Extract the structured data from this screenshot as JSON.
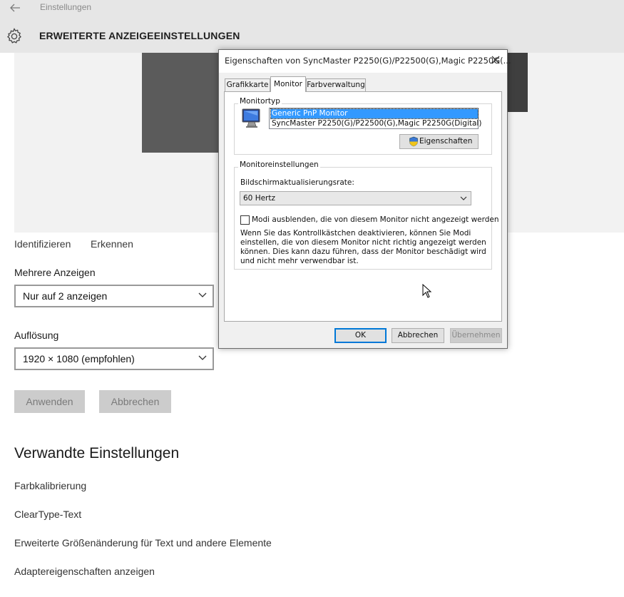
{
  "window": {
    "app_title": "Einstellungen",
    "page_title": "ERWEITERTE ANZEIGEEINSTELLUNGEN"
  },
  "display": {
    "identify_label": "Identifizieren",
    "detect_label": "Erkennen",
    "multi_label": "Mehrere Anzeigen",
    "multi_value": "Nur auf 2 anzeigen",
    "resolution_label": "Auflösung",
    "resolution_value": "1920 × 1080 (empfohlen)",
    "apply_label": "Anwenden",
    "cancel_label": "Abbrechen"
  },
  "related": {
    "title": "Verwandte Einstellungen",
    "links": [
      "Farbkalibrierung",
      "ClearType-Text",
      "Erweiterte Größenänderung für Text und andere Elemente",
      "Adaptereigenschaften anzeigen"
    ]
  },
  "dialog": {
    "title": "Eigenschaften von SyncMaster P2250(G)/P22500(G),Magic P2250G(...",
    "tabs": [
      "Grafikkarte",
      "Monitor",
      "Farbverwaltung"
    ],
    "active_tab": "Monitor",
    "monitor_type_group": "Monitortyp",
    "monitor_list": [
      "Generic PnP Monitor",
      "SyncMaster P2250(G)/P22500(G),Magic P2250G(Digital)"
    ],
    "properties_button": "Eigenschaften",
    "monitor_settings_group": "Monitoreinstellungen",
    "refresh_label": "Bildschirmaktualisierungsrate:",
    "refresh_value": "60 Hertz",
    "hide_modes_label": "Modi ausblenden, die von diesem Monitor nicht angezeigt werden",
    "hide_modes_checked": false,
    "warning_text": "Wenn Sie das Kontrollkästchen deaktivieren, können Sie Modi einstellen, die von diesem Monitor nicht richtig angezeigt werden können. Dies kann dazu führen, dass der Monitor beschädigt wird und nicht mehr verwendbar ist.",
    "ok_label": "OK",
    "cancel_label": "Abbrechen",
    "apply_label": "Übernehmen"
  },
  "icons": {
    "back": "back-arrow-icon",
    "settings": "gear-icon",
    "close": "close-icon",
    "monitor": "monitor-icon",
    "shield": "uac-shield-icon",
    "cursor": "mouse-cursor-icon"
  },
  "colors": {
    "header_bg": "#e6e6e6",
    "selection": "#3399ff",
    "focus_border": "#0078d7",
    "button_gray": "#cccccc"
  }
}
